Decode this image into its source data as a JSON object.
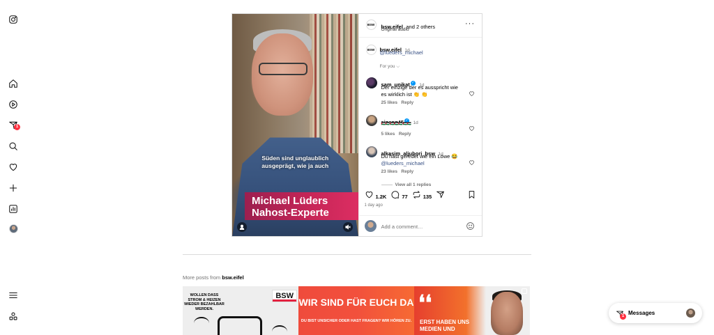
{
  "nav": {
    "items": [
      "instagram-logo",
      "home",
      "reels",
      "messages",
      "search",
      "notifications",
      "create",
      "dashboard",
      "profile",
      "more",
      "also-from-meta"
    ],
    "messages_badge": "1"
  },
  "post": {
    "header": {
      "user": "bsw.eifel",
      "and_others": "and 2 others",
      "audio": "Original audio",
      "avatar_text": "BSW"
    },
    "video": {
      "subtitle_line1": "Süden sind unglaublich",
      "subtitle_line2": "ausgeprägt, wie ja auch",
      "name_line1": "Michael Lüders",
      "name_line2": "Nahost-Experte"
    },
    "caption": {
      "user": "bsw.eifel",
      "time": "1d",
      "mention": "@lueders_michael"
    },
    "filter": "For you",
    "comments": [
      {
        "user": "sam_unikat",
        "time": "1d",
        "text": "Der einzige der es ausspricht wie es wirklich ist 👏 👏",
        "likes": "25 likes",
        "reply": "Reply"
      },
      {
        "user": "sinang45",
        "time": "1d",
        "text": "🇵🇸🇵🇸🇵🇸🇵🇸🇵🇸🇵🇸🇵🇸",
        "likes": "5 likes",
        "reply": "Reply"
      },
      {
        "user": "alkasim_aljubori_bsw",
        "time": "1d",
        "text": "Du hast geredet wie ein Löwe 😂",
        "mention": "@lueders_michael",
        "likes": "23 likes",
        "reply": "Reply",
        "view_replies": "View all 1 replies"
      }
    ],
    "stats": {
      "likes": "1.2K",
      "comments": "77",
      "reposts": "135"
    },
    "age": "1 day ago",
    "add_comment_placeholder": "Add a comment…"
  },
  "more_posts": {
    "prefix": "More posts from",
    "user": "bsw.eifel",
    "thumbs": [
      {
        "text": "WOLLEN DASS STROM & HEIZEN WIEDER BEZAHLBAR WERDEN.",
        "logo": "BSW"
      },
      {
        "headline": "WIR SIND FÜR EUCH DA",
        "sub": "DU BIST UNSICHER ODER HAST FRAGEN? WIR HÖREN ZU."
      },
      {
        "quote": "❛❛",
        "text": "ERST HABEN UNS MEDIEN UND"
      }
    ]
  },
  "messages_pill": {
    "label": "Messages",
    "badge": "1"
  },
  "colors": {
    "accent_link": "#385185",
    "badge": "#ff3040",
    "verified": "#0095f6",
    "lower_third": "#c82658"
  }
}
